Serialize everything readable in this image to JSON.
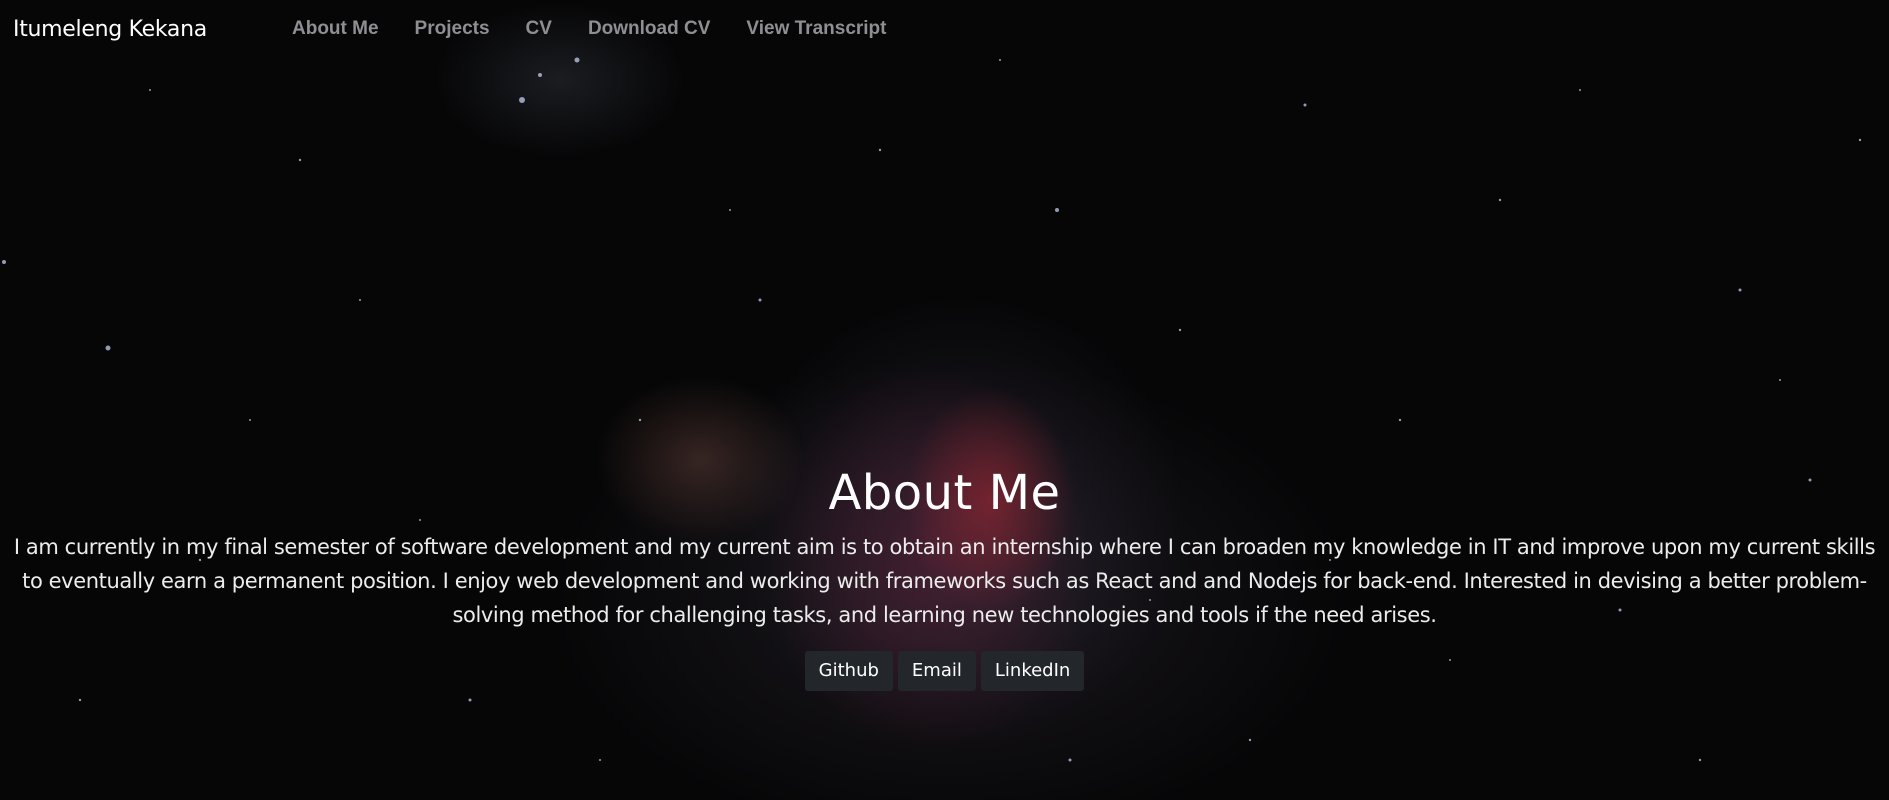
{
  "navbar": {
    "brand": "Itumeleng Kekana",
    "links": [
      {
        "label": "About Me"
      },
      {
        "label": "Projects"
      },
      {
        "label": "CV"
      },
      {
        "label": "Download CV"
      },
      {
        "label": "View Transcript"
      }
    ]
  },
  "hero": {
    "title": "About Me",
    "description": "I am currently in my final semester of software development and my current aim is to obtain an internship where I can broaden my knowledge in IT and improve upon my current skills to eventually earn a permanent position. I enjoy web development and working with frameworks such as React and and Nodejs for back-end. Interested in devising a better problem-solving method for challenging tasks, and learning new technologies and tools if the need arises.",
    "buttons": [
      {
        "label": "Github"
      },
      {
        "label": "Email"
      },
      {
        "label": "LinkedIn"
      }
    ]
  },
  "colors": {
    "background": "#060607",
    "nav_link": "#8f8f93",
    "button_bg": "#23262b",
    "text": "#ffffff"
  }
}
